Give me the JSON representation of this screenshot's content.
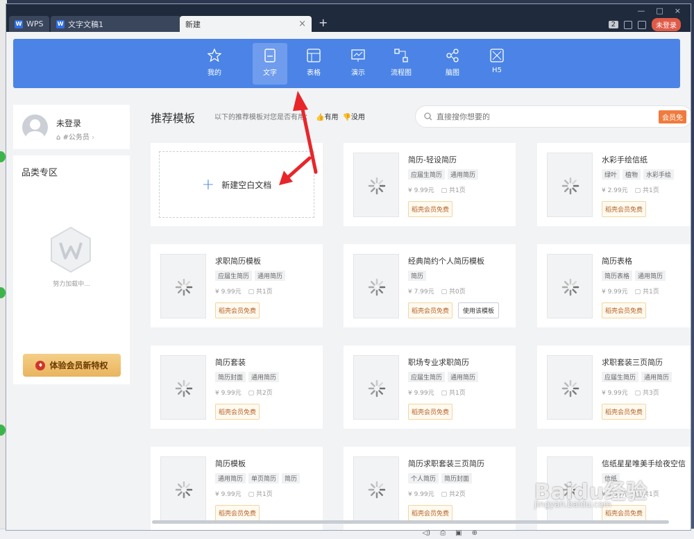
{
  "titlebar": {
    "tabs": [
      {
        "label": "WPS"
      },
      {
        "label": "文字文稿1"
      },
      {
        "label": "新建"
      }
    ],
    "add_tab": "+",
    "badge_count": "2",
    "login_label": "未登录"
  },
  "categories": [
    {
      "label": "我的",
      "icon": "star-icon"
    },
    {
      "label": "文字",
      "icon": "document-icon"
    },
    {
      "label": "表格",
      "icon": "spreadsheet-icon"
    },
    {
      "label": "演示",
      "icon": "presentation-icon"
    },
    {
      "label": "流程图",
      "icon": "flowchart-icon"
    },
    {
      "label": "脑图",
      "icon": "mindmap-icon"
    },
    {
      "label": "H5",
      "icon": "h5-icon"
    }
  ],
  "sidebar": {
    "user_name": "未登录",
    "user_tag": "#公务员",
    "section_title": "品类专区",
    "loading_text": "努力加载中...",
    "vip_button": "体验会员新特权"
  },
  "main": {
    "title": "推荐模板",
    "feedback_prompt": "以下的推荐模板对您是否有用：",
    "useful_label": "有用",
    "useless_label": "没用",
    "search_placeholder": "直接搜你想要的",
    "vip_free_badge": "会员免",
    "new_blank_label": "新建空白文档"
  },
  "templates": [
    {
      "title": "简历-轻设简历",
      "tags": [
        "应届生简历",
        "通用简历"
      ],
      "price": "9.99元",
      "pages": "共1页",
      "badge": "稻壳会员免费"
    },
    {
      "title": "水彩手绘信纸",
      "tags": [
        "绿叶",
        "植物",
        "水彩手绘"
      ],
      "price": "2.99元",
      "pages": "共1页",
      "badge": "稻壳会员免费"
    },
    {
      "title": "求职简历模板",
      "tags": [
        "应届生简历",
        "通用简历"
      ],
      "price": "9.99元",
      "pages": "共1页",
      "badge": "稻壳会员免费"
    },
    {
      "title": "经典简约个人简历模板",
      "tags": [
        "简历"
      ],
      "price": "7.99元",
      "pages": "共0页",
      "badge": "稻壳会员免费",
      "use_button": "使用该模板"
    },
    {
      "title": "简历表格",
      "tags": [
        "简历表格",
        "通用简历"
      ],
      "price": "9.99元",
      "pages": "共1页",
      "badge": "稻壳会员免费"
    },
    {
      "title": "简历套装",
      "tags": [
        "简历封面",
        "通用简历"
      ],
      "price": "9.99元",
      "pages": "共2页",
      "badge": "稻壳会员免费"
    },
    {
      "title": "职场专业求职简历",
      "tags": [
        "应届生简历",
        "通用简历"
      ],
      "price": "9.99元",
      "pages": "共1页",
      "badge": "稻壳会员免费"
    },
    {
      "title": "求职套装三页简历",
      "tags": [
        "应届生简历",
        "通用简历"
      ],
      "price": "9.99元",
      "pages": "共3页",
      "badge": "稻壳会员免费"
    },
    {
      "title": "简历模板",
      "tags": [
        "通用简历",
        "单页简历",
        "简历"
      ],
      "price": "9.99元",
      "pages": "共1页",
      "badge": "稻壳会员免费"
    },
    {
      "title": "简历求职套装三页简历",
      "tags": [
        "个人简历",
        "简历封面"
      ],
      "price": "9.99元",
      "pages": "共2页",
      "badge": "稻壳会员免费"
    },
    {
      "title": "信纸星星唯美手绘夜空信",
      "tags": [
        "信纸"
      ],
      "price": "9.99元",
      "pages": "共1页",
      "badge": "稻壳会员免费"
    }
  ],
  "watermark": {
    "main": "Baidu经验",
    "sub": "jingyan.baidu.com"
  },
  "colors": {
    "accent": "#4b84e6",
    "titlebar": "#1f2a3c",
    "vip_orange": "#f07b3d"
  }
}
